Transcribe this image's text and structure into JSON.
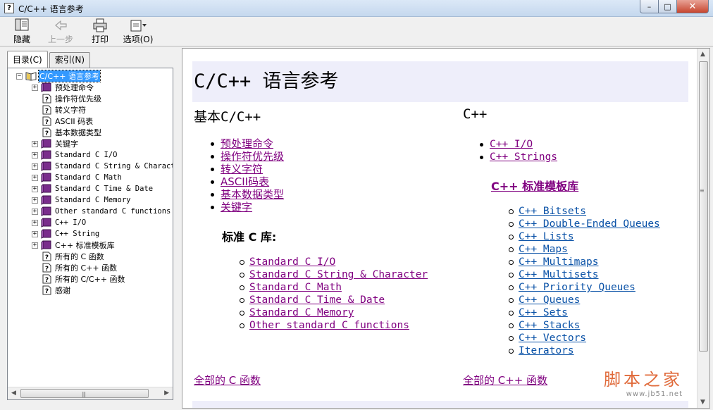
{
  "window": {
    "title": "C/C++ 语言参考",
    "minimize_glyph": "–",
    "maximize_glyph": "□",
    "close_glyph": "✕"
  },
  "toolbar": {
    "hide_label": "隐藏",
    "back_label": "上一步",
    "print_label": "打印",
    "options_label": "选项(O)"
  },
  "nav_tabs": {
    "contents_label": "目录(C)",
    "index_label": "索引(N)"
  },
  "tree": {
    "root": "C/C++ 语言参考",
    "items": [
      {
        "label": "预处理命令",
        "type": "book",
        "expandable": true,
        "mono": false
      },
      {
        "label": "操作符优先级",
        "type": "page",
        "expandable": false,
        "mono": false
      },
      {
        "label": "转义字符",
        "type": "page",
        "expandable": false,
        "mono": false
      },
      {
        "label": "ASCII 码表",
        "type": "page",
        "expandable": false,
        "mono": false
      },
      {
        "label": "基本数据类型",
        "type": "page",
        "expandable": false,
        "mono": false
      },
      {
        "label": "关键字",
        "type": "book",
        "expandable": true,
        "mono": false
      },
      {
        "label": "Standard C I/O",
        "type": "book",
        "expandable": true,
        "mono": true
      },
      {
        "label": "Standard C String & Character",
        "type": "book",
        "expandable": true,
        "mono": true
      },
      {
        "label": "Standard C Math",
        "type": "book",
        "expandable": true,
        "mono": true
      },
      {
        "label": "Standard C Time & Date",
        "type": "book",
        "expandable": true,
        "mono": true
      },
      {
        "label": "Standard C Memory",
        "type": "book",
        "expandable": true,
        "mono": true
      },
      {
        "label": "Other standard C functions",
        "type": "book",
        "expandable": true,
        "mono": true
      },
      {
        "label": "C++ I/O",
        "type": "book",
        "expandable": true,
        "mono": true
      },
      {
        "label": "C++ String",
        "type": "book",
        "expandable": true,
        "mono": true
      },
      {
        "label": "C++ 标准模板库",
        "type": "book",
        "expandable": true,
        "mono": false
      },
      {
        "label": "所有的 C 函数",
        "type": "page",
        "expandable": false,
        "mono": false
      },
      {
        "label": "所有的 C++ 函数",
        "type": "page",
        "expandable": false,
        "mono": false
      },
      {
        "label": "所有的 C/C++ 函数",
        "type": "page",
        "expandable": false,
        "mono": false
      },
      {
        "label": "感谢",
        "type": "page",
        "expandable": false,
        "mono": false
      }
    ]
  },
  "page": {
    "title": "C/C++ 语言参考",
    "basic_heading": "基本C/C++",
    "basic_links": [
      "预处理命令",
      "操作符优先级",
      "转义字符",
      "ASCII码表",
      "基本数据类型",
      "关键字"
    ],
    "stdc_heading": "标准 C 库:",
    "stdc_links": [
      "Standard C I/O",
      "Standard C String & Character",
      "Standard C Math",
      "Standard C Time & Date",
      "Standard C Memory",
      "Other standard C functions"
    ],
    "cpp_heading": "C++",
    "cpp_links": [
      "C++ I/O",
      "C++ Strings"
    ],
    "stl_heading": "C++ 标准模板库",
    "stl_links": [
      "C++ Bitsets",
      "C++ Double-Ended Queues",
      "C++ Lists",
      "C++ Maps",
      "C++ Multimaps",
      "C++ Multisets",
      "C++ Priority Queues",
      "C++ Queues",
      "C++ Sets",
      "C++ Stacks",
      "C++ Vectors",
      "Iterators"
    ],
    "all_c_link": "全部的 C 函数",
    "all_cpp_link": "全部的 C++ 函数"
  },
  "watermark": {
    "main": "脚本之家",
    "sub": "www.jb51.net"
  },
  "colors": {
    "visited_link": "#800080",
    "unvisited_link": "#0a52a7",
    "header_band": "#eeeefa",
    "selection": "#3399ff",
    "book_icon": "#7a2d8c"
  }
}
